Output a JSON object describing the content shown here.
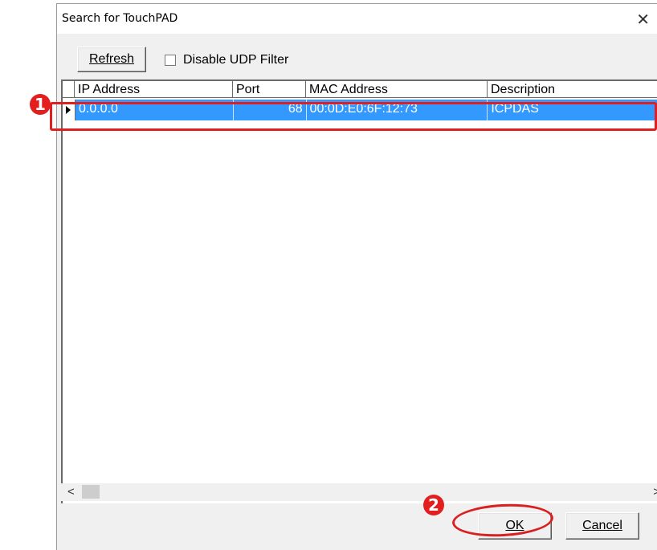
{
  "window": {
    "title": "Search for TouchPAD"
  },
  "toolbar": {
    "refresh_label": "Refresh",
    "udp_filter_label": "Disable UDP Filter",
    "udp_filter_checked": false
  },
  "grid": {
    "columns": [
      "IP Address",
      "Port",
      "MAC Address",
      "Description"
    ],
    "rows": [
      {
        "ip": "0.0.0.0",
        "port": "68",
        "mac": "00:0D:E0:6F:12:73",
        "description": "ICPDAS",
        "selected": true
      }
    ]
  },
  "footer": {
    "ok_label": "OK",
    "cancel_label": "Cancel"
  },
  "annotations": {
    "marker1": "1",
    "marker2": "2",
    "highlight_color": "#e21e1e"
  },
  "colors": {
    "selection": "#3399ff"
  },
  "icons": {
    "close": "close-icon",
    "row_pointer": "row-pointer-icon",
    "scroll_left": "scroll-left-icon",
    "scroll_right": "scroll-right-icon"
  }
}
